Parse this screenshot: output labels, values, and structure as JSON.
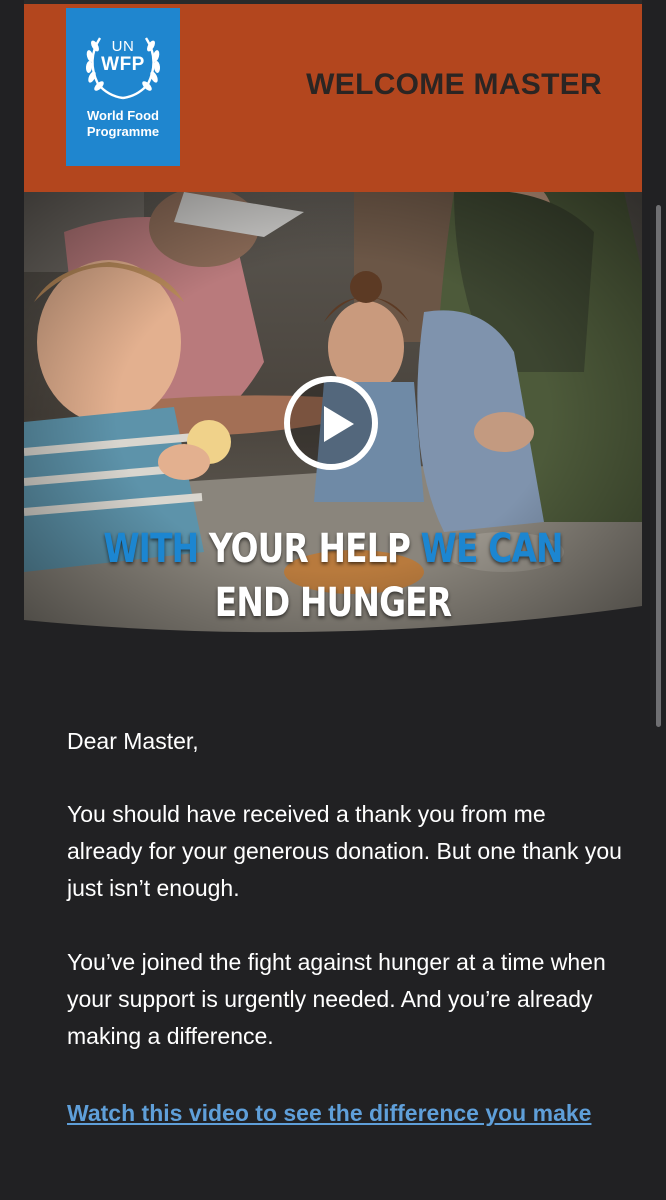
{
  "header": {
    "logo_un": "UN",
    "logo_wfp": "WFP",
    "logo_name_line1": "World Food",
    "logo_name_line2": "Programme",
    "title": "WELCOME MASTER",
    "band_color": "#b3461e",
    "logo_color": "#1f86cf"
  },
  "hero": {
    "tagline_part1_blue": "WITH",
    "tagline_part2_white": "YOUR HELP",
    "tagline_part3_blue": "WE CAN",
    "tagline_line2": "END HUNGER",
    "play_icon": "play-circle-icon",
    "accent_color": "#1c86d1"
  },
  "email": {
    "greeting": "Dear Master,",
    "paragraph1": "You should have received a thank you from me already for your generous donation. But one thank you just isn’t enough.",
    "paragraph2": "You’ve joined the fight against hunger at a time when your support is urgently needed. And you’re already making a difference.",
    "video_link": "Watch this video to see the difference you make",
    "link_color": "#5f9fd9"
  }
}
